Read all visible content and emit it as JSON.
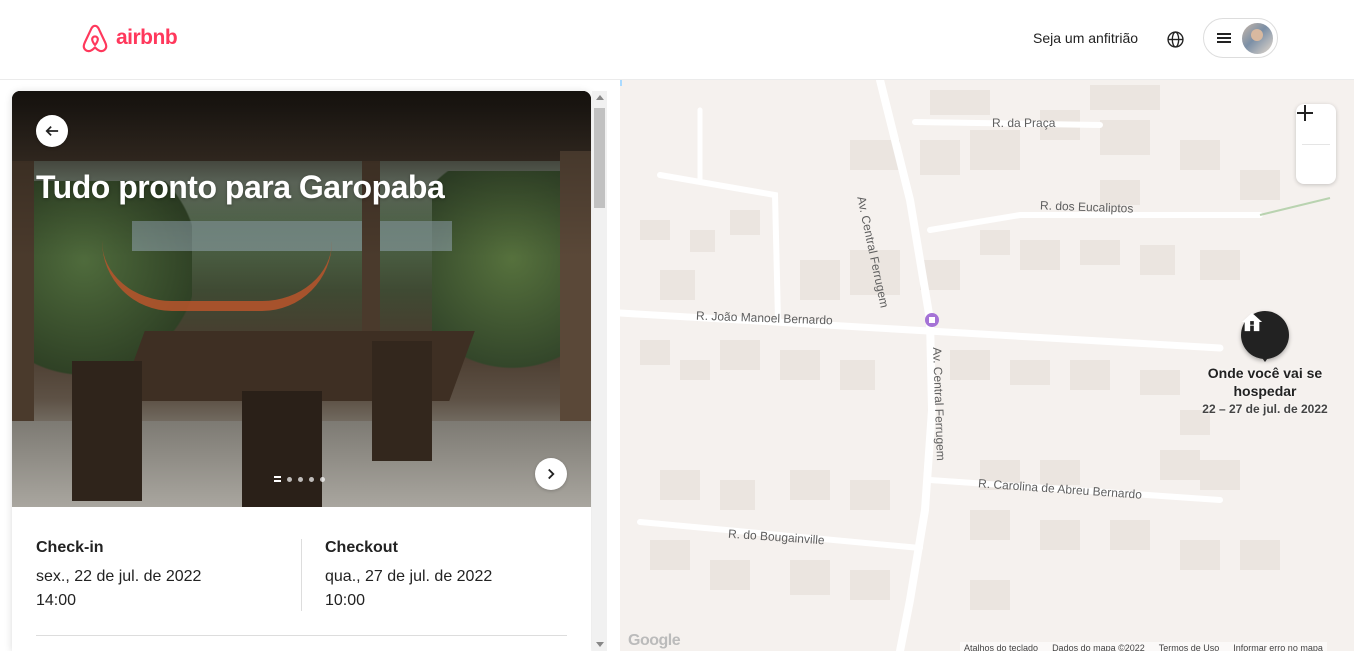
{
  "header": {
    "logo_text": "airbnb",
    "host_link": "Seja um anfitrião",
    "globe_icon": "globe-icon",
    "menu_icon": "hamburger-menu-icon",
    "colors": {
      "brand": "#ff385c"
    }
  },
  "hero": {
    "title": "Tudo pronto para Garopaba",
    "back_icon": "arrow-left-icon",
    "next_icon": "chevron-right-icon",
    "photo_count": 5,
    "active_photo": 1
  },
  "stay": {
    "checkin": {
      "label": "Check-in",
      "date": "sex., 22 de jul. de 2022",
      "time": "14:00"
    },
    "checkout": {
      "label": "Checkout",
      "date": "qua., 27 de jul. de 2022",
      "time": "10:00"
    }
  },
  "map": {
    "streets": {
      "praca": "R. da Praça",
      "central_top": "Av. Central Ferrugem",
      "eucaliptos": "R. dos Eucaliptos",
      "joao_manoel": "R. João Manoel Bernardo",
      "central_bottom": "Av. Central Ferrugem",
      "carolina": "R. Carolina de Abreu Bernardo",
      "bougainville": "R. do Bougainville"
    },
    "pin": {
      "title": "Onde você vai se hospedar",
      "dates": "22 – 27 de jul. de 2022",
      "icon": "house-icon"
    },
    "zoom_in": "+",
    "zoom_out": "−",
    "google": "Google",
    "footer": {
      "shortcuts": "Atalhos do teclado",
      "data": "Dados do mapa ©2022",
      "terms": "Termos de Uso",
      "report": "Informar erro no mapa"
    }
  }
}
